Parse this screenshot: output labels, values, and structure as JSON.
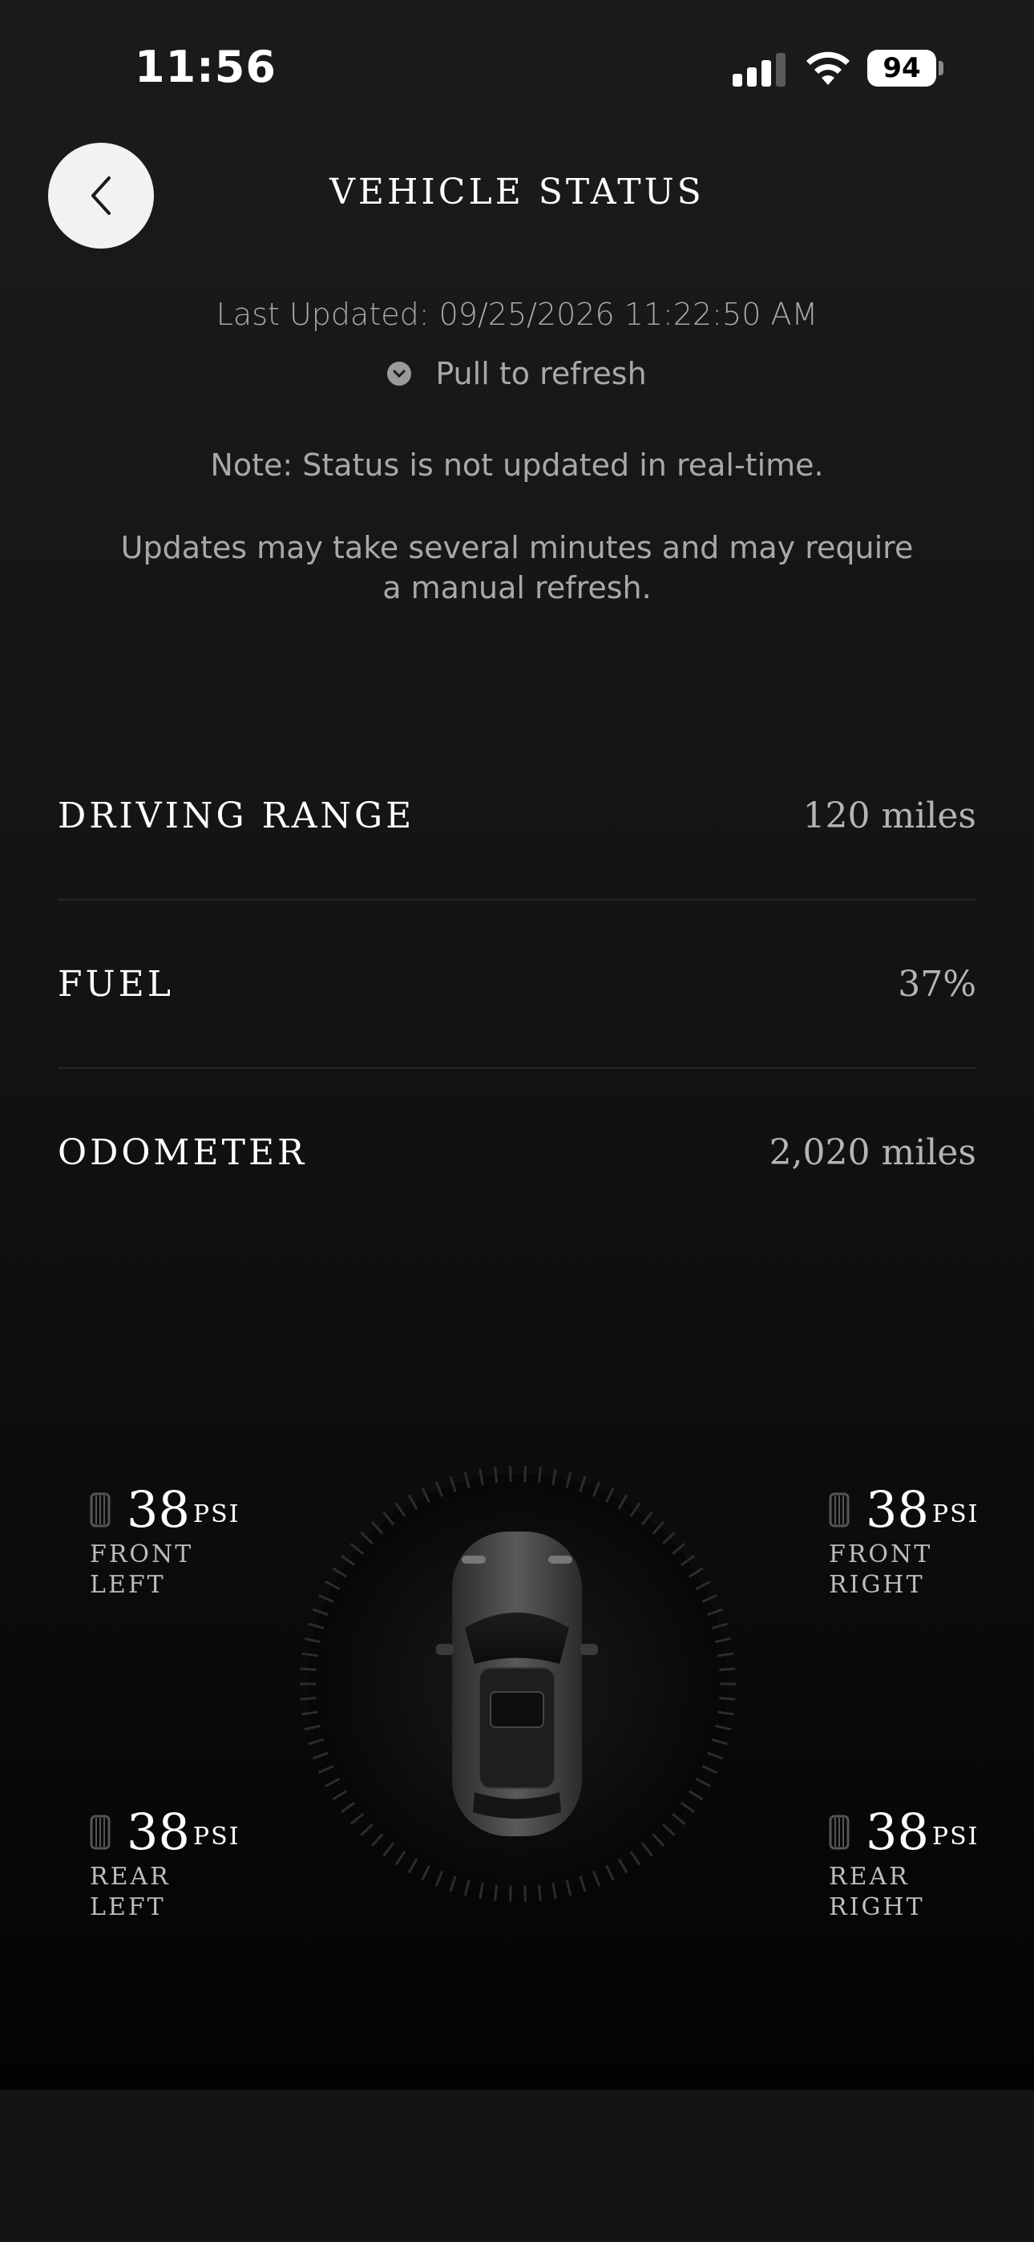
{
  "status_bar": {
    "time": "11:56",
    "battery_level": "94"
  },
  "header": {
    "back_icon": "chevron-left-icon",
    "title": "VEHICLE STATUS"
  },
  "info": {
    "last_updated": "Last Updated: 09/25/2026 11:22:50 AM",
    "refresh_icon": "chevron-down-circle-icon",
    "pull_to_refresh": "Pull to refresh",
    "note": "Note: Status is not updated in real-time.",
    "updates": "Updates may take several minutes and may require a manual refresh."
  },
  "stats": [
    {
      "label": "DRIVING RANGE",
      "value": "120 miles"
    },
    {
      "label": "FUEL",
      "value": "37%"
    },
    {
      "label": "ODOMETER",
      "value": "2,020 miles"
    }
  ],
  "tires": {
    "unit": "PSI",
    "front_left": {
      "value": "38",
      "line1": "FRONT",
      "line2": "LEFT"
    },
    "front_right": {
      "value": "38",
      "line1": "FRONT",
      "line2": "RIGHT"
    },
    "rear_left": {
      "value": "38",
      "line1": "REAR",
      "line2": "LEFT"
    },
    "rear_right": {
      "value": "38",
      "line1": "REAR",
      "line2": "RIGHT"
    }
  },
  "colors": {
    "background": "#141414",
    "primary_text": "#ffffff",
    "secondary_text": "#a8a8a8"
  }
}
